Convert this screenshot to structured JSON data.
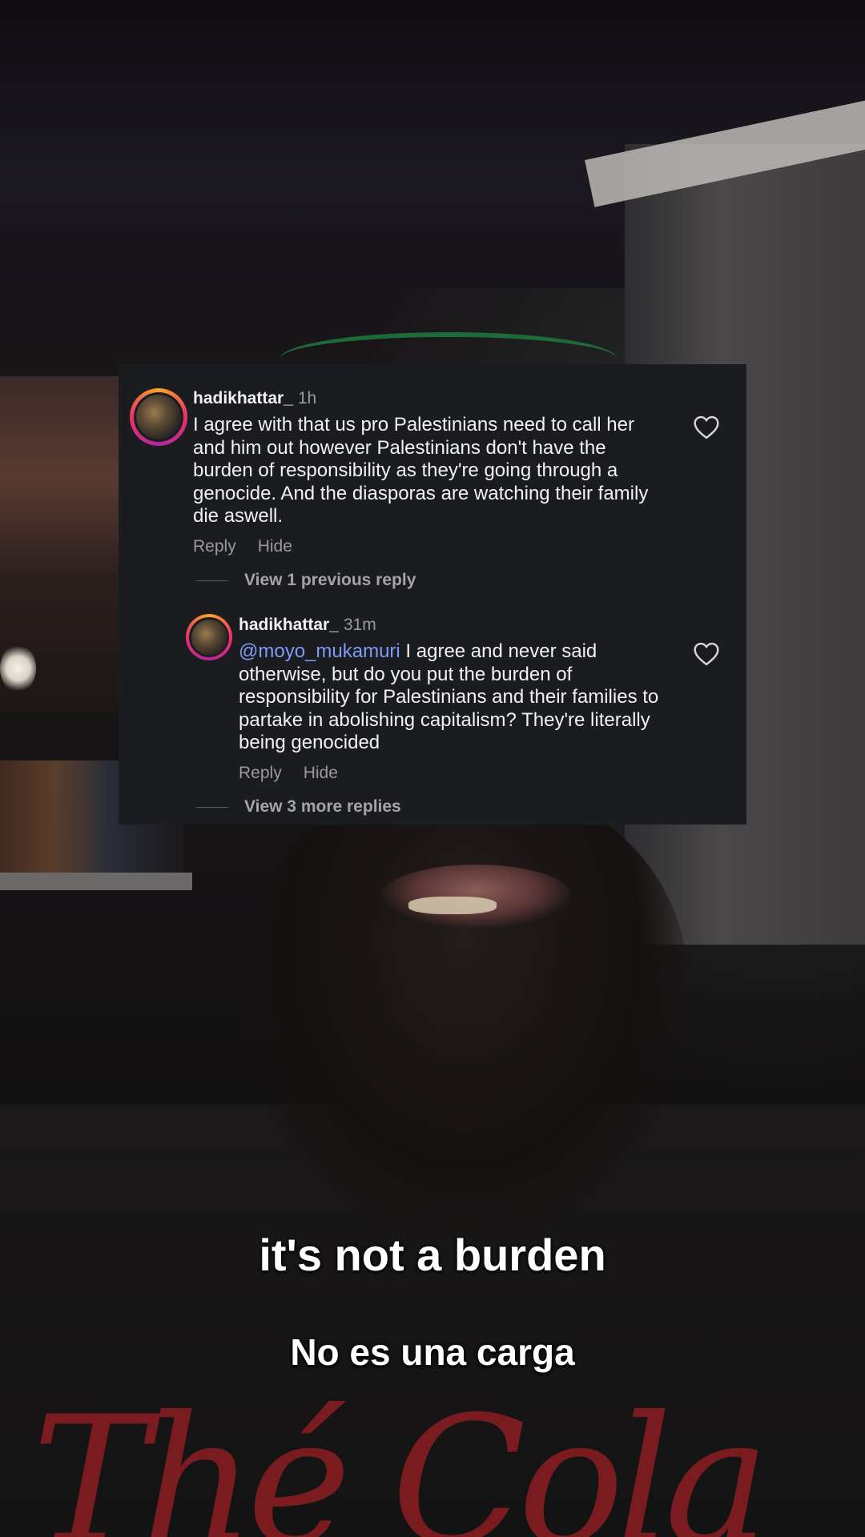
{
  "comments": [
    {
      "username": "hadikhattar_",
      "time": "1h",
      "mention": "",
      "text": "I agree with that us pro Palestinians need to call her and him out however Palestinians don't have the burden of responsibility as they're going through a genocide. And the diasporas are watching their family die aswell.",
      "reply_label": "Reply",
      "hide_label": "Hide",
      "view_replies": "View 1 previous reply"
    },
    {
      "username": "hadikhattar_",
      "time": "31m",
      "mention": "@moyo_mukamuri",
      "text": "I agree and never said otherwise, but do you put the burden of responsibility  for Palestinians and their families to partake in abolishing capitalism? They're literally being genocided",
      "reply_label": "Reply",
      "hide_label": "Hide",
      "view_replies": "View 3 more replies"
    }
  ],
  "captions": {
    "english": "it's not a burden",
    "spanish": "No es una carga"
  },
  "icons": {
    "like": "heart-outline-icon",
    "avatar_ring": "instagram-story-ring"
  },
  "colors": {
    "card_background": "#1b1c20",
    "mention": "#7f9bf3",
    "muted_text": "#9a9a9e",
    "shirt_logo": "#8b1d22"
  }
}
